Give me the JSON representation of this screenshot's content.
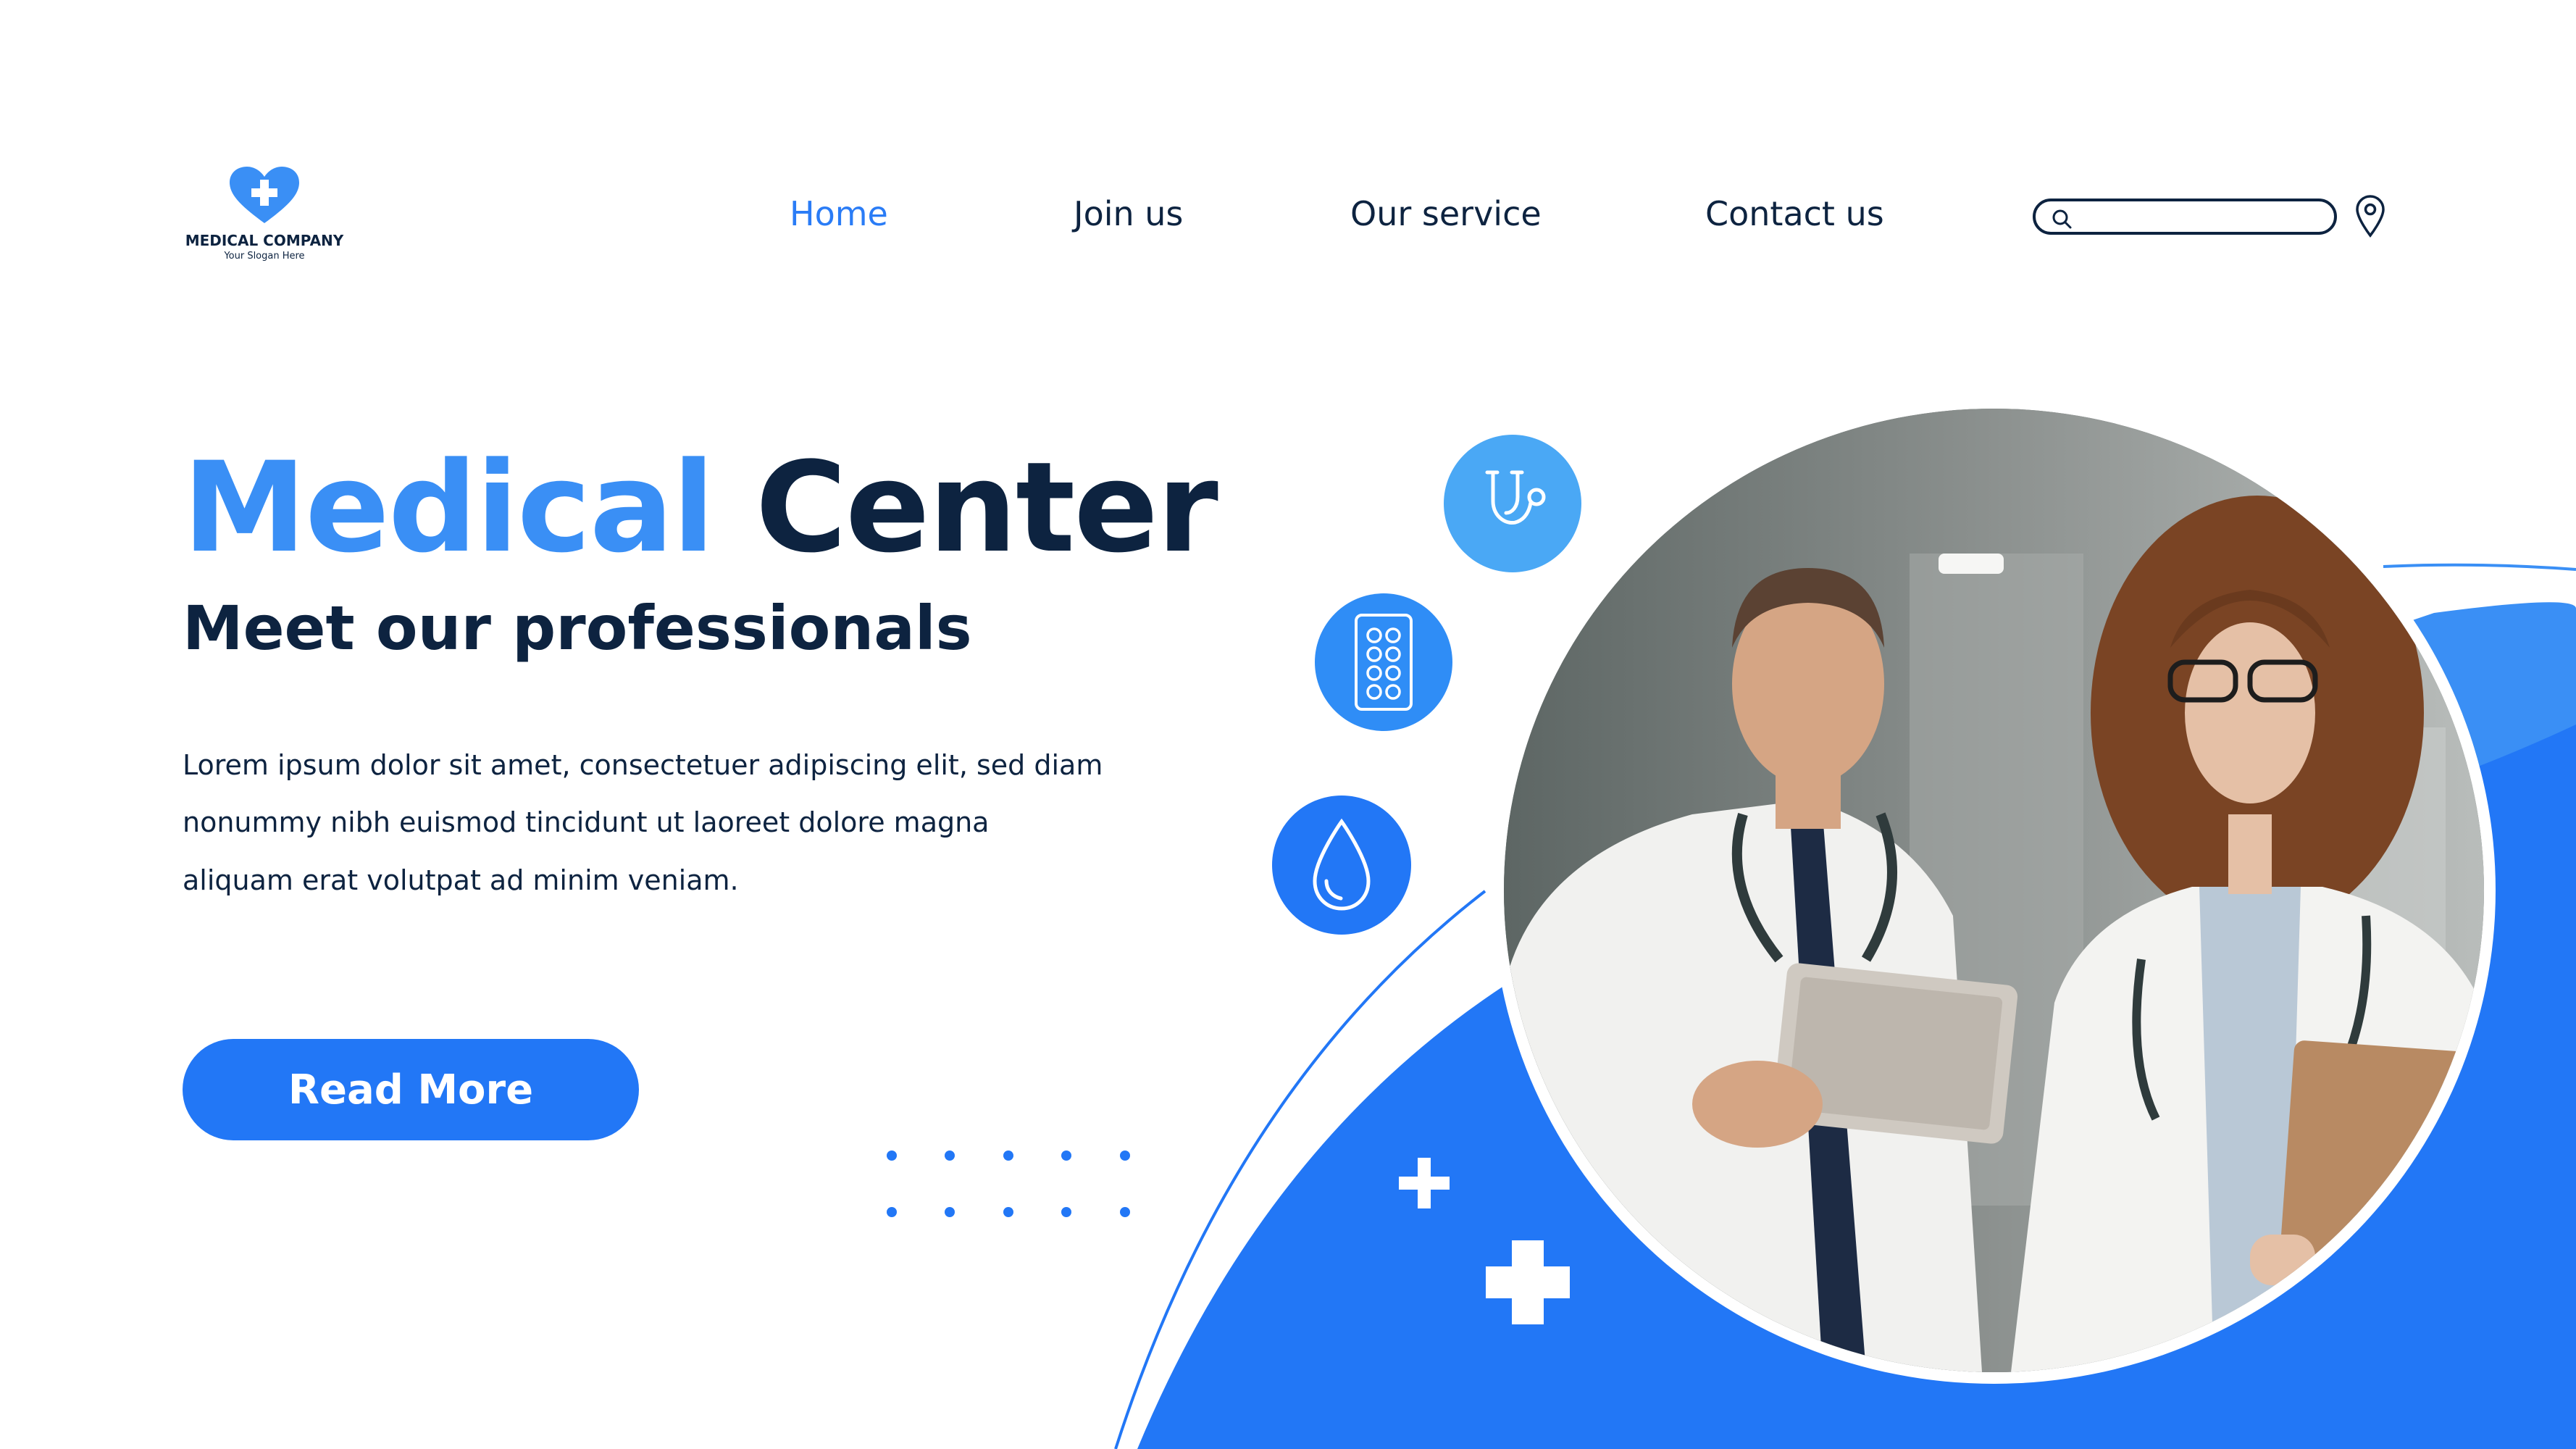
{
  "logo": {
    "name": "MEDICAL COMPANY",
    "slogan": "Your Slogan Here",
    "icon": "heart-plus-icon"
  },
  "nav": {
    "items": [
      {
        "label": "Home",
        "active": true
      },
      {
        "label": "Join us",
        "active": false
      },
      {
        "label": "Our service",
        "active": false
      },
      {
        "label": "Contact us",
        "active": false
      }
    ]
  },
  "search": {
    "placeholder": "",
    "value": "",
    "icon": "search-icon"
  },
  "location": {
    "icon": "map-pin-icon"
  },
  "hero": {
    "title_part1": "Medical",
    "title_part2": "Center",
    "subtitle": "Meet our professionals",
    "body": [
      "Lorem ipsum dolor sit amet, consectetuer adipiscing elit, sed diam",
      "nonummy nibh euismod tincidunt ut laoreet dolore magna",
      "aliquam erat volutpat ad minim veniam."
    ],
    "button_label": "Read More"
  },
  "feature_icons": [
    "stethoscope-icon",
    "pills-icon",
    "blood-drop-icon"
  ],
  "colors": {
    "accent": "#2277f6",
    "accent_light": "#4aa8f5",
    "dark": "#0d2340"
  },
  "image": {
    "subject": "doctors-photo"
  }
}
